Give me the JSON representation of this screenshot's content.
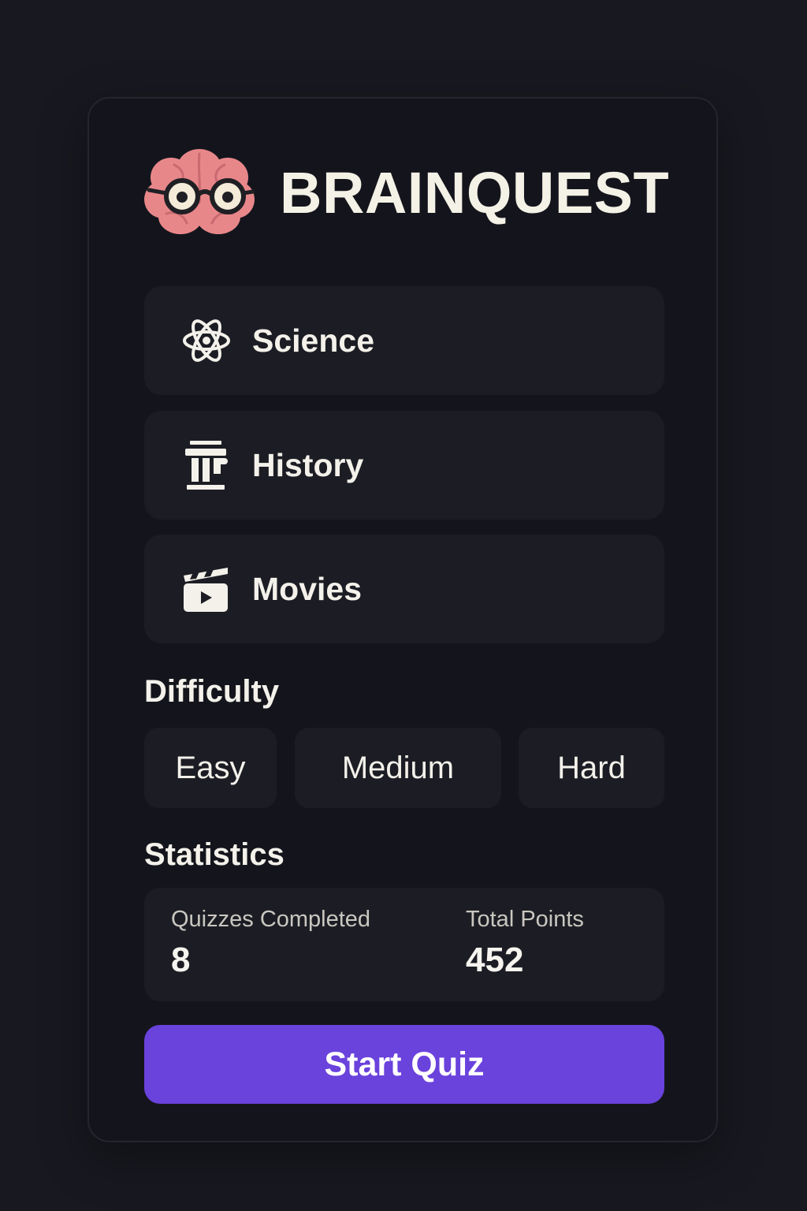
{
  "app": {
    "title": "BRAINQUEST",
    "logo_icon": "brain-with-glasses-icon"
  },
  "categories": [
    {
      "label": "Science",
      "icon": "atom-icon"
    },
    {
      "label": "History",
      "icon": "pillar-icon"
    },
    {
      "label": "Movies",
      "icon": "clapperboard-icon"
    }
  ],
  "difficulty": {
    "heading": "Difficulty",
    "options": [
      "Easy",
      "Medium",
      "Hard"
    ]
  },
  "statistics": {
    "heading": "Statistics",
    "quizzes_completed": {
      "label": "Quizzes Completed",
      "value": "8"
    },
    "total_points": {
      "label": "Total Points",
      "value": "452"
    }
  },
  "start_button": {
    "label": "Start Quiz"
  },
  "colors": {
    "background": "#181920",
    "card": "#14151c",
    "tile": "#1c1d24",
    "accent": "#6a42dc",
    "text": "#f3f1ea",
    "brain": "#e8878a"
  }
}
